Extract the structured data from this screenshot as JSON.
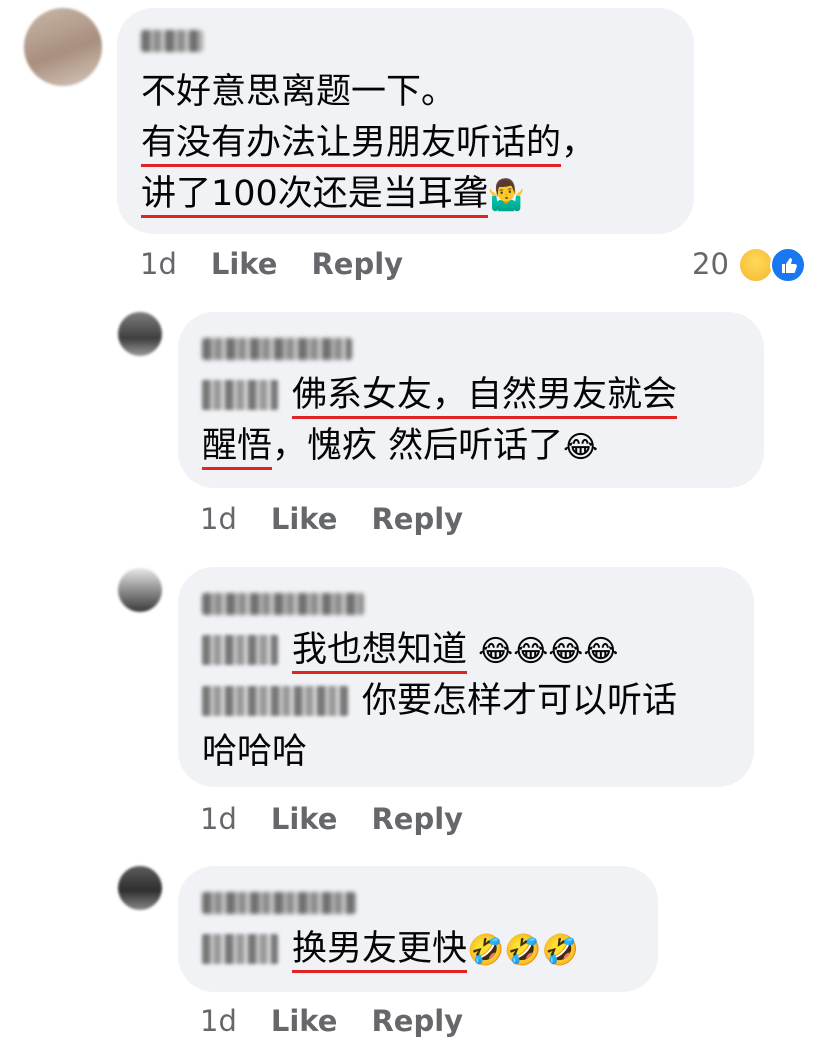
{
  "comments": [
    {
      "name": "",
      "lines": [
        {
          "plain": "不好意思离题一下。"
        },
        {
          "underlined": "有没有办法让男朋友听话的",
          "tail": "，"
        },
        {
          "underlined": "讲了100次还是当耳聋",
          "tail": ""
        }
      ],
      "emoji_end": "🤷‍♂️",
      "time": "1d",
      "like": "Like",
      "reply": "Reply",
      "reaction_count": "20",
      "reaction_icons": [
        "laughing-emoji-icon",
        "thumbs-up-icon"
      ]
    },
    {
      "name": "",
      "line1_underlined": "佛系女友，自然男友就会",
      "line2_underlined": "醒悟",
      "line2_rest": "，愧疚 然后听话了",
      "emoji": "😂",
      "time": "1d",
      "like": "Like",
      "reply": "Reply"
    },
    {
      "name": "",
      "line1_underlined": "我也想知道",
      "emojis": "😂😂😂😂",
      "line2_rest": "你要怎样才可以听话",
      "line3": "哈哈哈",
      "time": "1d",
      "like": "Like",
      "reply": "Reply"
    },
    {
      "name": "",
      "line1_underlined": "换男友更快",
      "emojis": "🤣🤣🤣",
      "time": "1d",
      "like": "Like",
      "reply": "Reply"
    }
  ],
  "colors": {
    "bubble": "#f0f2f5",
    "meta": "#65676b",
    "underline": "#e02424",
    "like_blue": "#1877f2"
  }
}
